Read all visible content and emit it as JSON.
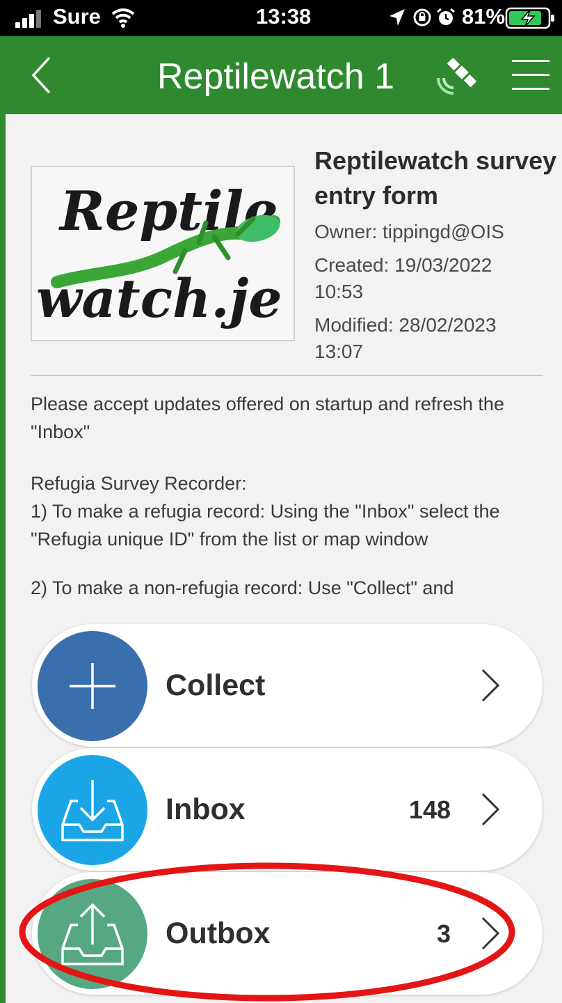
{
  "status_bar": {
    "carrier": "Sure",
    "time": "13:38",
    "battery": "81%",
    "icons": [
      "signal-icon",
      "wifi-icon",
      "location-arrow-icon",
      "rotation-lock-icon",
      "alarm-icon",
      "battery-charging-icon"
    ]
  },
  "navbar": {
    "title": "Reptilewatch 1",
    "icons": [
      "back-chevron-icon",
      "gps-satellite-icon",
      "hamburger-menu-icon"
    ]
  },
  "survey": {
    "logo_text": [
      "Reptile",
      "watch.je"
    ],
    "title": "Reptilewatch survey entry form",
    "owner": "Owner: tippingd@OIS",
    "created": "Created: 19/03/2022 10:53",
    "modified": "Modified: 28/02/2023 13:07"
  },
  "description": {
    "p1": "Please accept updates offered on startup and refresh the \"Inbox\"",
    "p2_line1": "Refugia Survey Recorder:",
    "p2_line2": "1) To make a refugia record: Using the \"Inbox\" select the \"Refugia unique ID\" from the list or map window",
    "p3": "2) To make a non-refugia record: Use \"Collect\" and"
  },
  "actions": {
    "collect": {
      "label": "Collect",
      "count": "",
      "color": "#3a6fad",
      "icon": "plus-icon"
    },
    "inbox": {
      "label": "Inbox",
      "count": "148",
      "color": "#1aa6e6",
      "icon": "inbox-download-icon"
    },
    "outbox": {
      "label": "Outbox",
      "count": "3",
      "color": "#56a882",
      "icon": "outbox-upload-icon"
    }
  },
  "colors": {
    "navbar": "#2f8a2f",
    "content_bg": "#f2f2f2",
    "highlight": "#e41515"
  }
}
